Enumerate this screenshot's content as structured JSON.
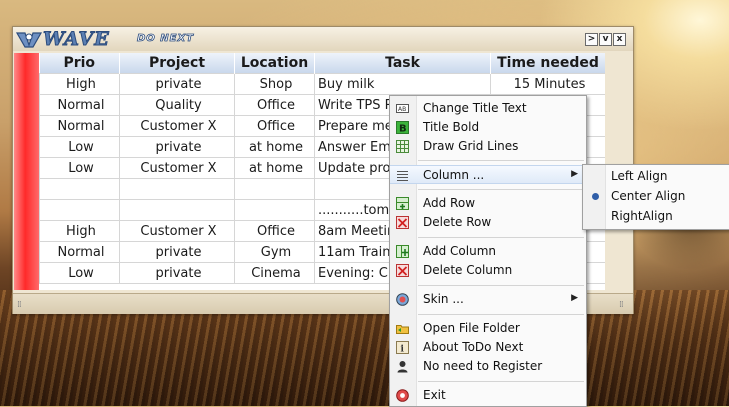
{
  "app": {
    "logo": "WAVE",
    "subtitle": "DO NEXT"
  },
  "titlebar": {
    "buttons": [
      ">",
      "v",
      "x"
    ]
  },
  "columns": [
    "Prio",
    "Project",
    "Location",
    "Task",
    "Time needed"
  ],
  "rows": [
    [
      "High",
      "private",
      "Shop",
      "Buy milk",
      "15 Minutes"
    ],
    [
      "Normal",
      "Quality",
      "Office",
      "Write TPS R",
      ""
    ],
    [
      "Normal",
      "Customer X",
      "Office",
      "Prepare mee",
      ""
    ],
    [
      "Low",
      "private",
      "at home",
      "Answer Ema",
      ""
    ],
    [
      "Low",
      "Customer X",
      "at home",
      "Update proj",
      ""
    ],
    [
      "",
      "",
      "",
      "",
      ""
    ],
    [
      "",
      "",
      "",
      "...........tom",
      ""
    ],
    [
      "High",
      "Customer X",
      "Office",
      "8am Meetin",
      ""
    ],
    [
      "Normal",
      "private",
      "Gym",
      "11am Traini",
      ""
    ],
    [
      "Low",
      "private",
      "Cinema",
      "Evening: Cir",
      ""
    ]
  ],
  "context_menu": {
    "items": {
      "change_title": "Change Title Text",
      "title_bold": "Title Bold",
      "draw_grid": "Draw Grid Lines",
      "column": "Column ...",
      "add_row": "Add Row",
      "delete_row": "Delete Row",
      "add_column": "Add Column",
      "delete_column": "Delete Column",
      "skin": "Skin ...",
      "open_folder": "Open File Folder",
      "about": "About ToDo Next",
      "register": "No need to Register",
      "exit": "Exit"
    }
  },
  "column_submenu": {
    "items": [
      "Left Align",
      "Center Align",
      "RightAlign"
    ],
    "selected": "Center Align"
  },
  "colors": {
    "accent": "#2c4c7d",
    "row_marker": "#ff2a2a",
    "menu_highlight": "#dfeaf8"
  }
}
